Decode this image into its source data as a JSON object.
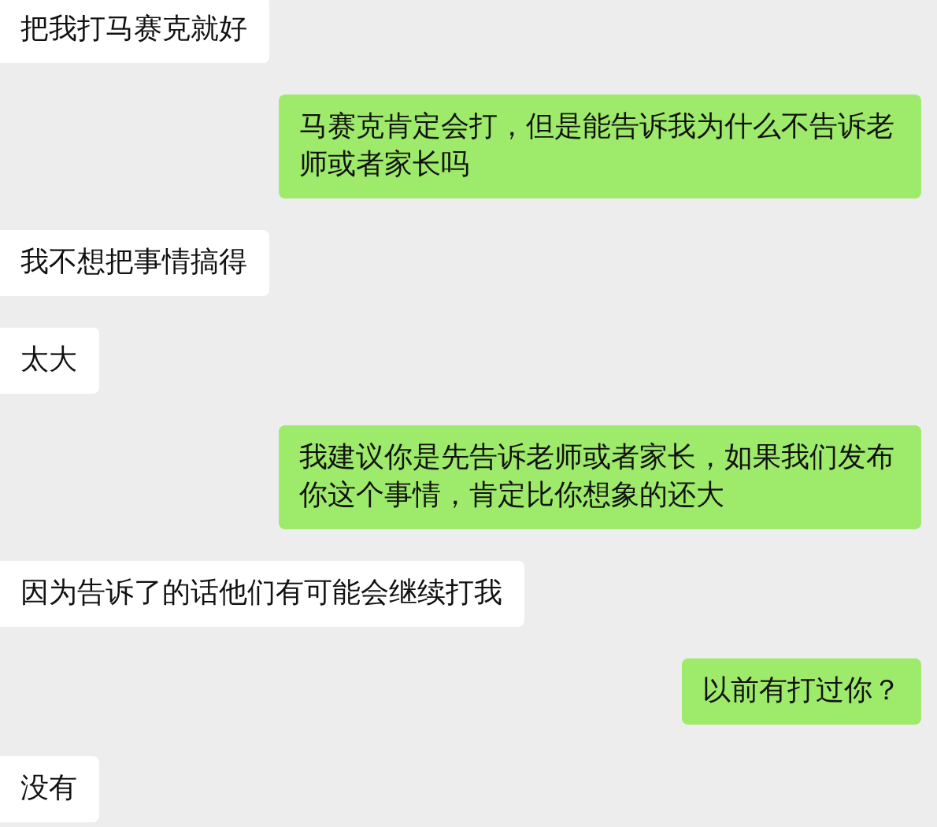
{
  "messages": [
    {
      "kind": "received",
      "text": "把我打马赛克就好"
    },
    {
      "kind": "sent",
      "text": "马赛克肯定会打，但是能告诉我为什么不告诉老师或者家长吗"
    },
    {
      "kind": "received",
      "text": "我不想把事情搞得"
    },
    {
      "kind": "received",
      "text": "太大"
    },
    {
      "kind": "sent",
      "text": "我建议你是先告诉老师或者家长，如果我们发布你这个事情，肯定比你想象的还大"
    },
    {
      "kind": "received",
      "text": "因为告诉了的话他们有可能会继续打我"
    },
    {
      "kind": "sent",
      "text": "以前有打过你？"
    },
    {
      "kind": "received",
      "text": "没有"
    }
  ]
}
